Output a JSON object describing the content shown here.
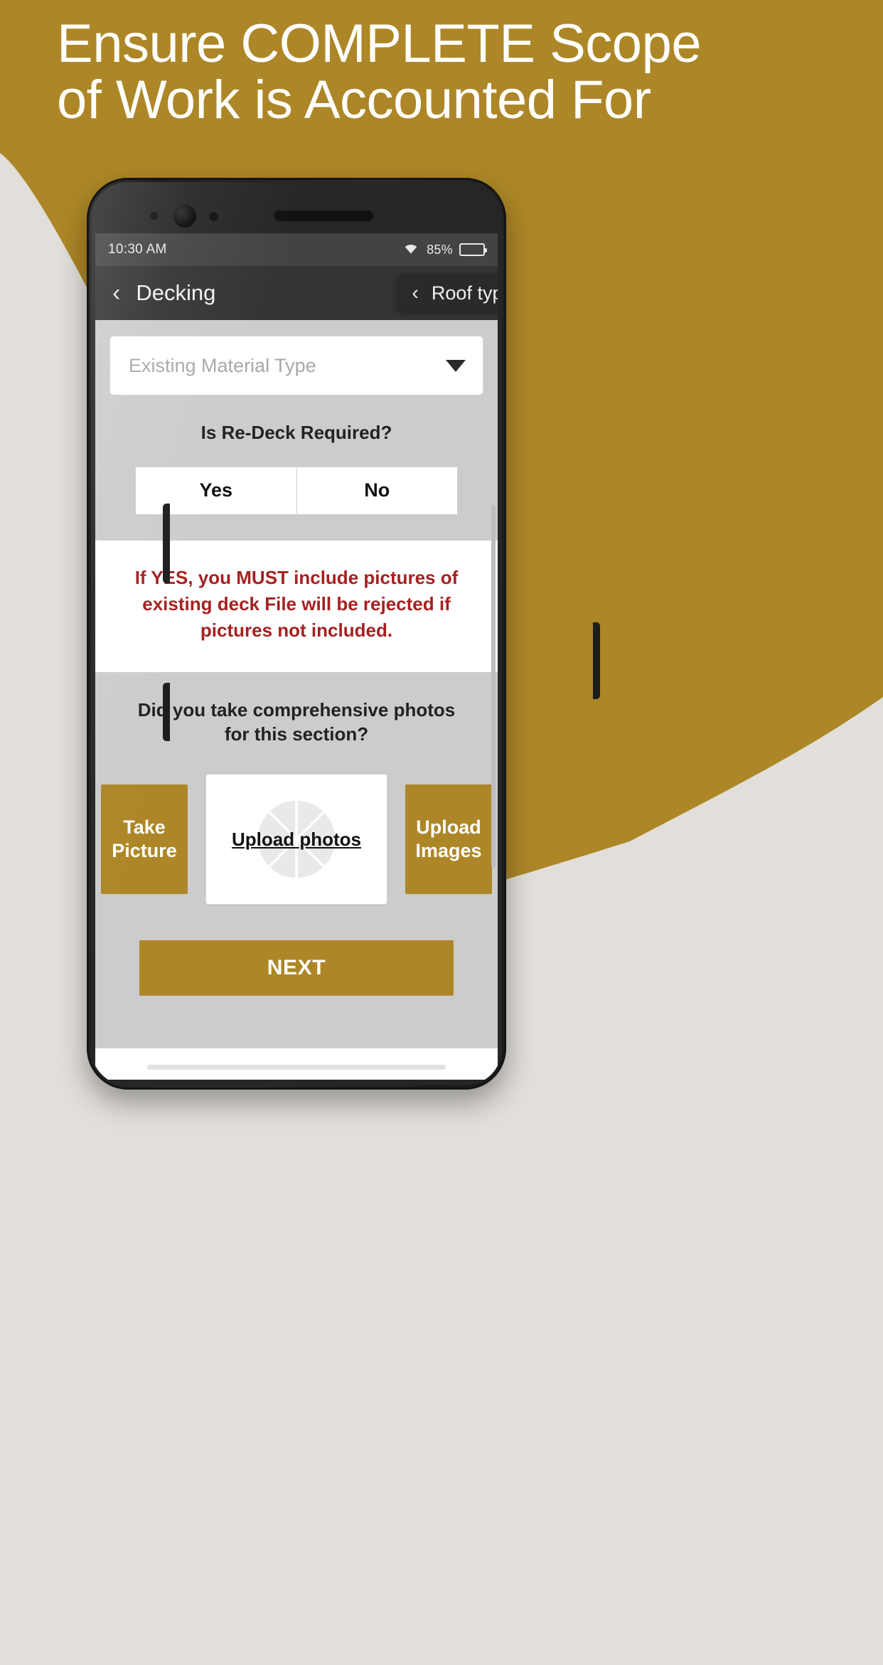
{
  "colors": {
    "gold": "#AD8727",
    "page_bg": "#E2DFDA",
    "warning_red": "#A52121",
    "app_bg": "#CCCCCC",
    "navbar": "#333333"
  },
  "headline": {
    "line1": "Ensure COMPLETE Scope",
    "line2": "of Work is Accounted For"
  },
  "phone": {
    "statusbar": {
      "time": "10:30 AM",
      "wifi_icon": "wifi-icon",
      "battery_percent": "85%",
      "battery_icon": "battery-icon"
    },
    "navbar": {
      "back_icon": "chevron-left-icon",
      "title": "Decking",
      "pill": {
        "back_icon": "chevron-left-icon",
        "label": "Roof types"
      }
    },
    "form": {
      "material_select": {
        "placeholder": "Existing Material Type",
        "value": "",
        "caret_icon": "chevron-down-icon"
      },
      "redeck_question": "Is Re-Deck Required?",
      "redeck_options": [
        "Yes",
        "No"
      ],
      "warning": "If YES, you MUST include pictures of existing deck File will be rejected if pictures not included.",
      "photos_question": "Did you take comprehensive photos for this section?",
      "take_picture_label": "Take Picture",
      "upload_card_label": "Upload photos",
      "upload_card_icon": "shutter-icon",
      "upload_images_label": "Upload Images",
      "next_label": "NEXT"
    }
  }
}
